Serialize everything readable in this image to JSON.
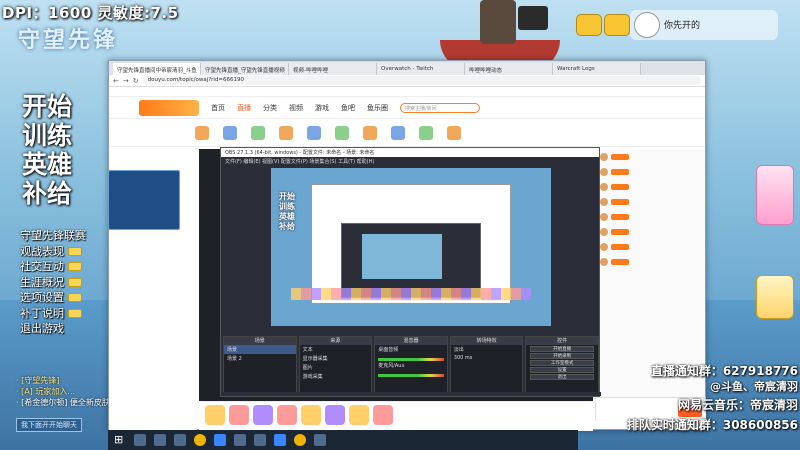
{
  "overlay": {
    "dpi_text": "DPI：1600 灵敏度:7.5",
    "logo_text": "守望先锋",
    "big_lines": [
      "开始",
      "训练",
      "英雄",
      "补给"
    ],
    "menu_items": [
      "守望先锋联赛",
      "观战表现",
      "社交互动",
      "生涯概况",
      "选项设置",
      "补丁说明",
      "退出游戏"
    ],
    "chat_lines": [
      "· [守望先锋]",
      "· [A] 玩家加入...",
      "· [希金德尔顿] 便全新皮肤"
    ],
    "left_button": "我下面开开始聊天",
    "right_lines": [
      "直播通知群：627918776",
      "@斗鱼、帝宸清羽",
      "网易云音乐：帝宸清羽",
      "排队实时通知群：308600856"
    ],
    "top_right_name": "你先开的"
  },
  "browser": {
    "tabs": [
      "守望先锋直播间中帝宸清羽_斗鱼",
      "守望先锋直播_守望先锋直播视频",
      "视频-哔哩哔哩",
      "Overwatch - Twitch",
      "哔哩哔哩动态",
      "Warcraft Logs"
    ],
    "url": "douyu.com/topic/owaj?rid=666190",
    "nav": [
      "首页",
      "直播",
      "分类",
      "视频",
      "游戏",
      "鱼吧",
      "鱼乐圈"
    ],
    "active_nav": "直播",
    "search_placeholder": "搜索主播/房间"
  },
  "obs": {
    "title": "OBS 27.1.3 (64-bit, windows) - 配置文件: 未命名 - 场景: 未命名",
    "menu": "文件(F)  编辑(E)  视图(V)  配置文件(P)  场景集合(S)  工具(T)  帮助(H)",
    "panels": {
      "scenes": {
        "header": "场景",
        "items": [
          "场景",
          "场景 2"
        ]
      },
      "sources": {
        "header": "来源",
        "items": [
          "文本",
          "显示器采集",
          "图片",
          "游戏采集"
        ]
      },
      "mixer": {
        "header": "混音器",
        "items": [
          "桌面音频",
          "麦克风/Aux"
        ]
      },
      "transitions": {
        "header": "转场特效",
        "items": [
          "淡出",
          "300 ms"
        ]
      },
      "controls": {
        "header": "控件",
        "items": [
          "开始直播",
          "开始录制",
          "工作室模式",
          "设置",
          "退出"
        ]
      }
    }
  },
  "colors": {
    "accent": "#ff5d23",
    "obs_bg": "#2b2e38",
    "taskbar": "#1c2735"
  }
}
